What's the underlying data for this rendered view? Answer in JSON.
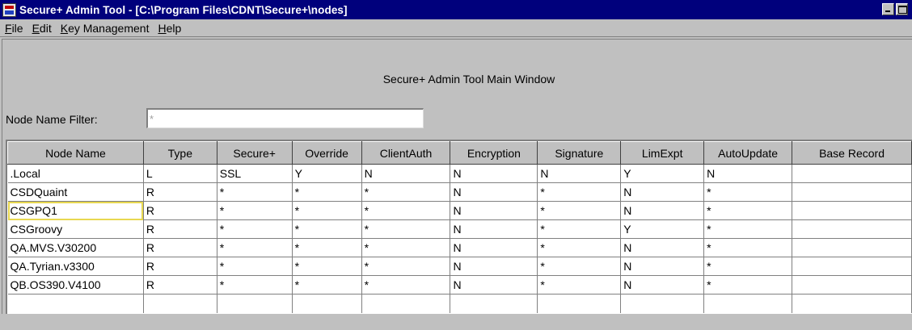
{
  "window": {
    "title": "Secure+ Admin Tool - [C:\\Program Files\\CDNT\\Secure+\\nodes]",
    "icon": "secure-plus-app-icon"
  },
  "menu": [
    {
      "accel": "F",
      "rest": "ile"
    },
    {
      "accel": "E",
      "rest": "dit"
    },
    {
      "accel": "K",
      "rest": "ey Management"
    },
    {
      "accel": "H",
      "rest": "elp"
    }
  ],
  "main": {
    "caption": "Secure+ Admin Tool Main Window",
    "filter_label": "Node Name Filter:",
    "filter_value": "*"
  },
  "table": {
    "columns": [
      "Node Name",
      "Type",
      "Secure+",
      "Override",
      "ClientAuth",
      "Encryption",
      "Signature",
      "LimExpt",
      "AutoUpdate",
      "Base Record"
    ],
    "rows": [
      [
        ".Local",
        "L",
        "SSL",
        "Y",
        "N",
        "N",
        "N",
        "Y",
        "N",
        ""
      ],
      [
        "CSDQuaint",
        "R",
        "*",
        "*",
        "*",
        "N",
        "*",
        "N",
        "*",
        ""
      ],
      [
        "CSGPQ1",
        "R",
        "*",
        "*",
        "*",
        "N",
        "*",
        "N",
        "*",
        ""
      ],
      [
        "CSGroovy",
        "R",
        "*",
        "*",
        "*",
        "N",
        "*",
        "Y",
        "*",
        ""
      ],
      [
        "QA.MVS.V30200",
        "R",
        "*",
        "*",
        "*",
        "N",
        "*",
        "N",
        "*",
        ""
      ],
      [
        "QA.Tyrian.v3300",
        "R",
        "*",
        "*",
        "*",
        "N",
        "*",
        "N",
        "*",
        ""
      ],
      [
        "QB.OS390.V4100",
        "R",
        "*",
        "*",
        "*",
        "N",
        "*",
        "N",
        "*",
        ""
      ]
    ],
    "focused_cell": "CSGPQ1"
  }
}
